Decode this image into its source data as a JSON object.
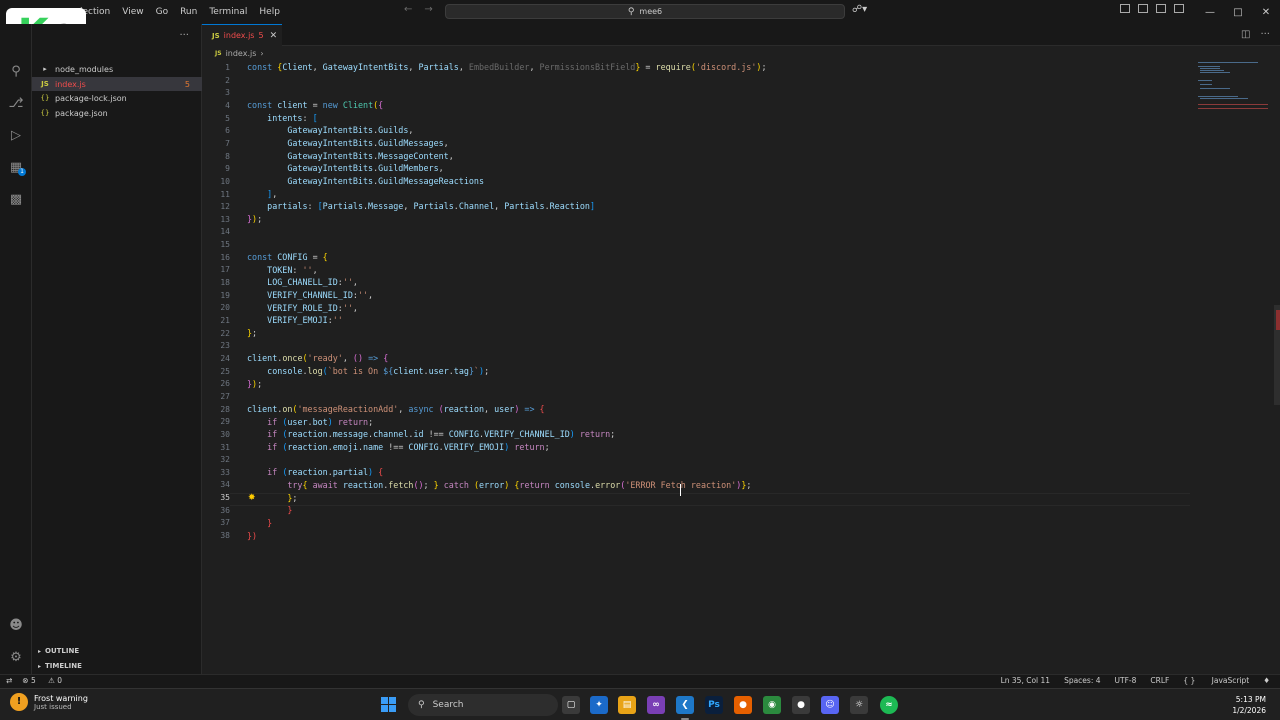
{
  "menu": [
    "lection",
    "View",
    "Go",
    "Run",
    "Terminal",
    "Help"
  ],
  "search": {
    "text": "mee6"
  },
  "logo": {
    "letter": "K",
    "number": "2"
  },
  "explorer": {
    "items": [
      {
        "label": "node_modules",
        "type": "folder"
      },
      {
        "label": "index.js",
        "type": "js",
        "count": "5"
      },
      {
        "label": "package-lock.json",
        "type": "json"
      },
      {
        "label": "package.json",
        "type": "json"
      }
    ],
    "outline": "OUTLINE",
    "timeline": "TIMELINE"
  },
  "tab": {
    "name": "index.js",
    "problems": "5"
  },
  "breadcrumb": {
    "file": "index.js"
  },
  "editor": {
    "line_numbers": [
      "1",
      "2",
      "3",
      "4",
      "5",
      "6",
      "7",
      "8",
      "9",
      "10",
      "11",
      "12",
      "13",
      "14",
      "15",
      "16",
      "17",
      "18",
      "19",
      "20",
      "21",
      "22",
      "23",
      "24",
      "25",
      "26",
      "27",
      "28",
      "29",
      "30",
      "31",
      "32",
      "33",
      "34",
      "35",
      "36",
      "37",
      "38"
    ],
    "current_line": 35
  },
  "status": {
    "errors": "5",
    "warnings": "0",
    "position": "Ln 35, Col 11",
    "spaces": "Spaces: 4",
    "encoding": "UTF-8",
    "eol": "CRLF",
    "language": "JavaScript"
  },
  "taskbar": {
    "weather_title": "Frost warning",
    "weather_sub": "Just issued",
    "search_label": "Search",
    "time": "5:13 PM",
    "date": "1/2/2026"
  }
}
